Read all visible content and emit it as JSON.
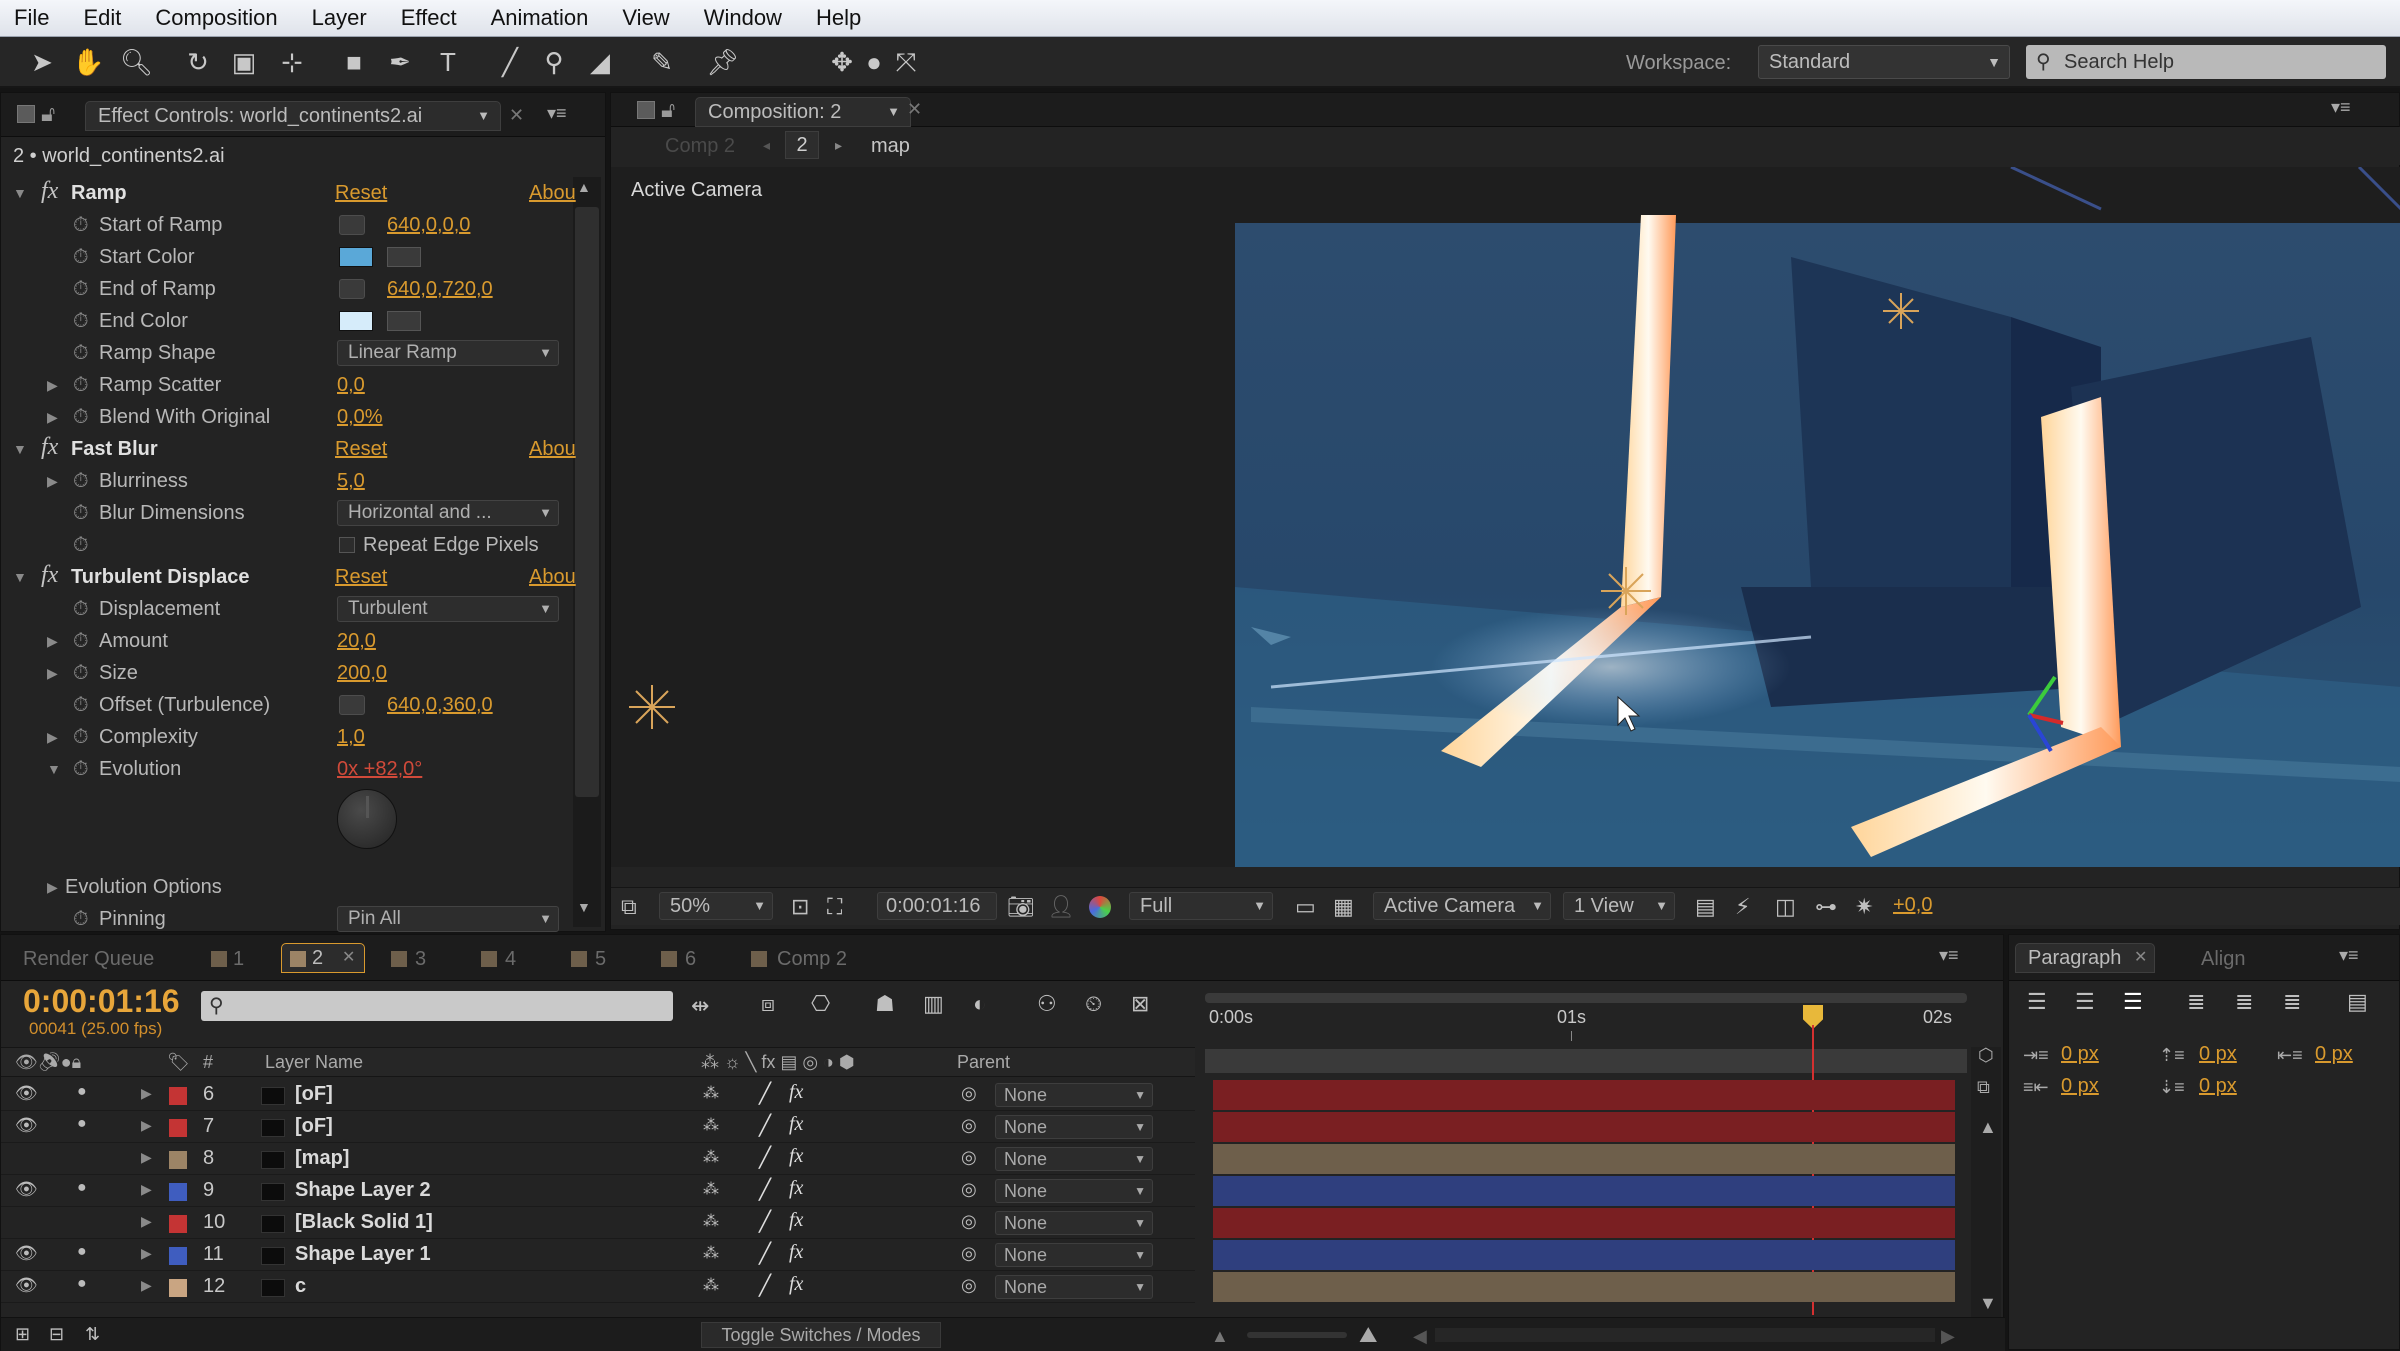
{
  "menu": [
    "File",
    "Edit",
    "Composition",
    "Layer",
    "Effect",
    "Animation",
    "View",
    "Window",
    "Help"
  ],
  "toolbar": {
    "workspace_label": "Workspace:",
    "workspace_value": "Standard",
    "search_placeholder": "Search Help"
  },
  "effect_controls": {
    "tab_label": "Effect Controls: world_continents2.ai",
    "layer_label": "2 • world_continents2.ai",
    "reset": "Reset",
    "about": "Abou",
    "ramp": {
      "name": "Ramp",
      "start_of_ramp_label": "Start of Ramp",
      "start_of_ramp": "640,0,0,0",
      "start_color_label": "Start Color",
      "end_of_ramp_label": "End of Ramp",
      "end_of_ramp": "640,0,720,0",
      "end_color_label": "End Color",
      "ramp_shape_label": "Ramp Shape",
      "ramp_shape": "Linear Ramp",
      "ramp_scatter_label": "Ramp Scatter",
      "ramp_scatter": "0,0",
      "blend_label": "Blend With Original",
      "blend": "0,0%",
      "start_color": "#5aa8d8",
      "end_color": "#d6ecfa"
    },
    "fast_blur": {
      "name": "Fast Blur",
      "blurriness_label": "Blurriness",
      "blurriness": "5,0",
      "blur_dimensions_label": "Blur Dimensions",
      "blur_dimensions": "Horizontal and ...",
      "repeat_edge_label": "Repeat Edge Pixels"
    },
    "turbulent": {
      "name": "Turbulent Displace",
      "displacement_label": "Displacement",
      "displacement": "Turbulent",
      "amount_label": "Amount",
      "amount": "20,0",
      "size_label": "Size",
      "size": "200,0",
      "offset_label": "Offset (Turbulence)",
      "offset": "640,0,360,0",
      "complexity_label": "Complexity",
      "complexity": "1,0",
      "evolution_label": "Evolution",
      "evolution": "0x +82,0°",
      "evolution_options_label": "Evolution Options",
      "pinning_label": "Pinning",
      "pinning": "Pin All"
    }
  },
  "composition": {
    "tab_label": "Composition: 2",
    "breadcrumb_comp": "Comp 2",
    "breadcrumb_2": "2",
    "breadcrumb_map": "map",
    "view_label": "Active Camera",
    "zoom": "50%",
    "timecode": "0:00:01:16",
    "resolution": "Full",
    "camera": "Active Camera",
    "views": "1 View",
    "exposure": "+0,0"
  },
  "timeline": {
    "tabs": [
      "Render Queue",
      "1",
      "2",
      "3",
      "4",
      "5",
      "6",
      "Comp 2"
    ],
    "timecode": "0:00:01:16",
    "fps": "00041 (25.00 fps)",
    "search_placeholder": "",
    "header_layer_name": "Layer Name",
    "header_hash": "#",
    "header_parent": "Parent",
    "ruler": [
      "0:00s",
      "01s",
      "02s"
    ],
    "toggle_label": "Toggle Switches / Modes",
    "layers": [
      {
        "num": "6",
        "name": "[oF]",
        "parent": "None",
        "label_color": "#c43434",
        "bar_color": "#7a1f22"
      },
      {
        "num": "7",
        "name": "[oF]",
        "parent": "None",
        "label_color": "#c43434",
        "bar_color": "#7a1f22"
      },
      {
        "num": "8",
        "name": "[map]",
        "parent": "None",
        "label_color": "#9c8466",
        "bar_color": "#6e5f4b"
      },
      {
        "num": "9",
        "name": "Shape Layer 2",
        "parent": "None",
        "label_color": "#3f5dbf",
        "bar_color": "#2f3f7e"
      },
      {
        "num": "10",
        "name": "[Black Solid 1]",
        "parent": "None",
        "label_color": "#c43434",
        "bar_color": "#7a1f22"
      },
      {
        "num": "11",
        "name": "Shape Layer 1",
        "parent": "None",
        "label_color": "#3f5dbf",
        "bar_color": "#2f3f7e"
      },
      {
        "num": "12",
        "name": "c",
        "parent": "None",
        "label_color": "#c9a582",
        "bar_color": "#6e5f4b"
      }
    ]
  },
  "paragraph": {
    "tab_paragraph": "Paragraph",
    "tab_align": "Align",
    "px1": "0 px",
    "px2": "0 px",
    "px3": "0 px",
    "px4": "0 px",
    "px5": "0 px"
  }
}
